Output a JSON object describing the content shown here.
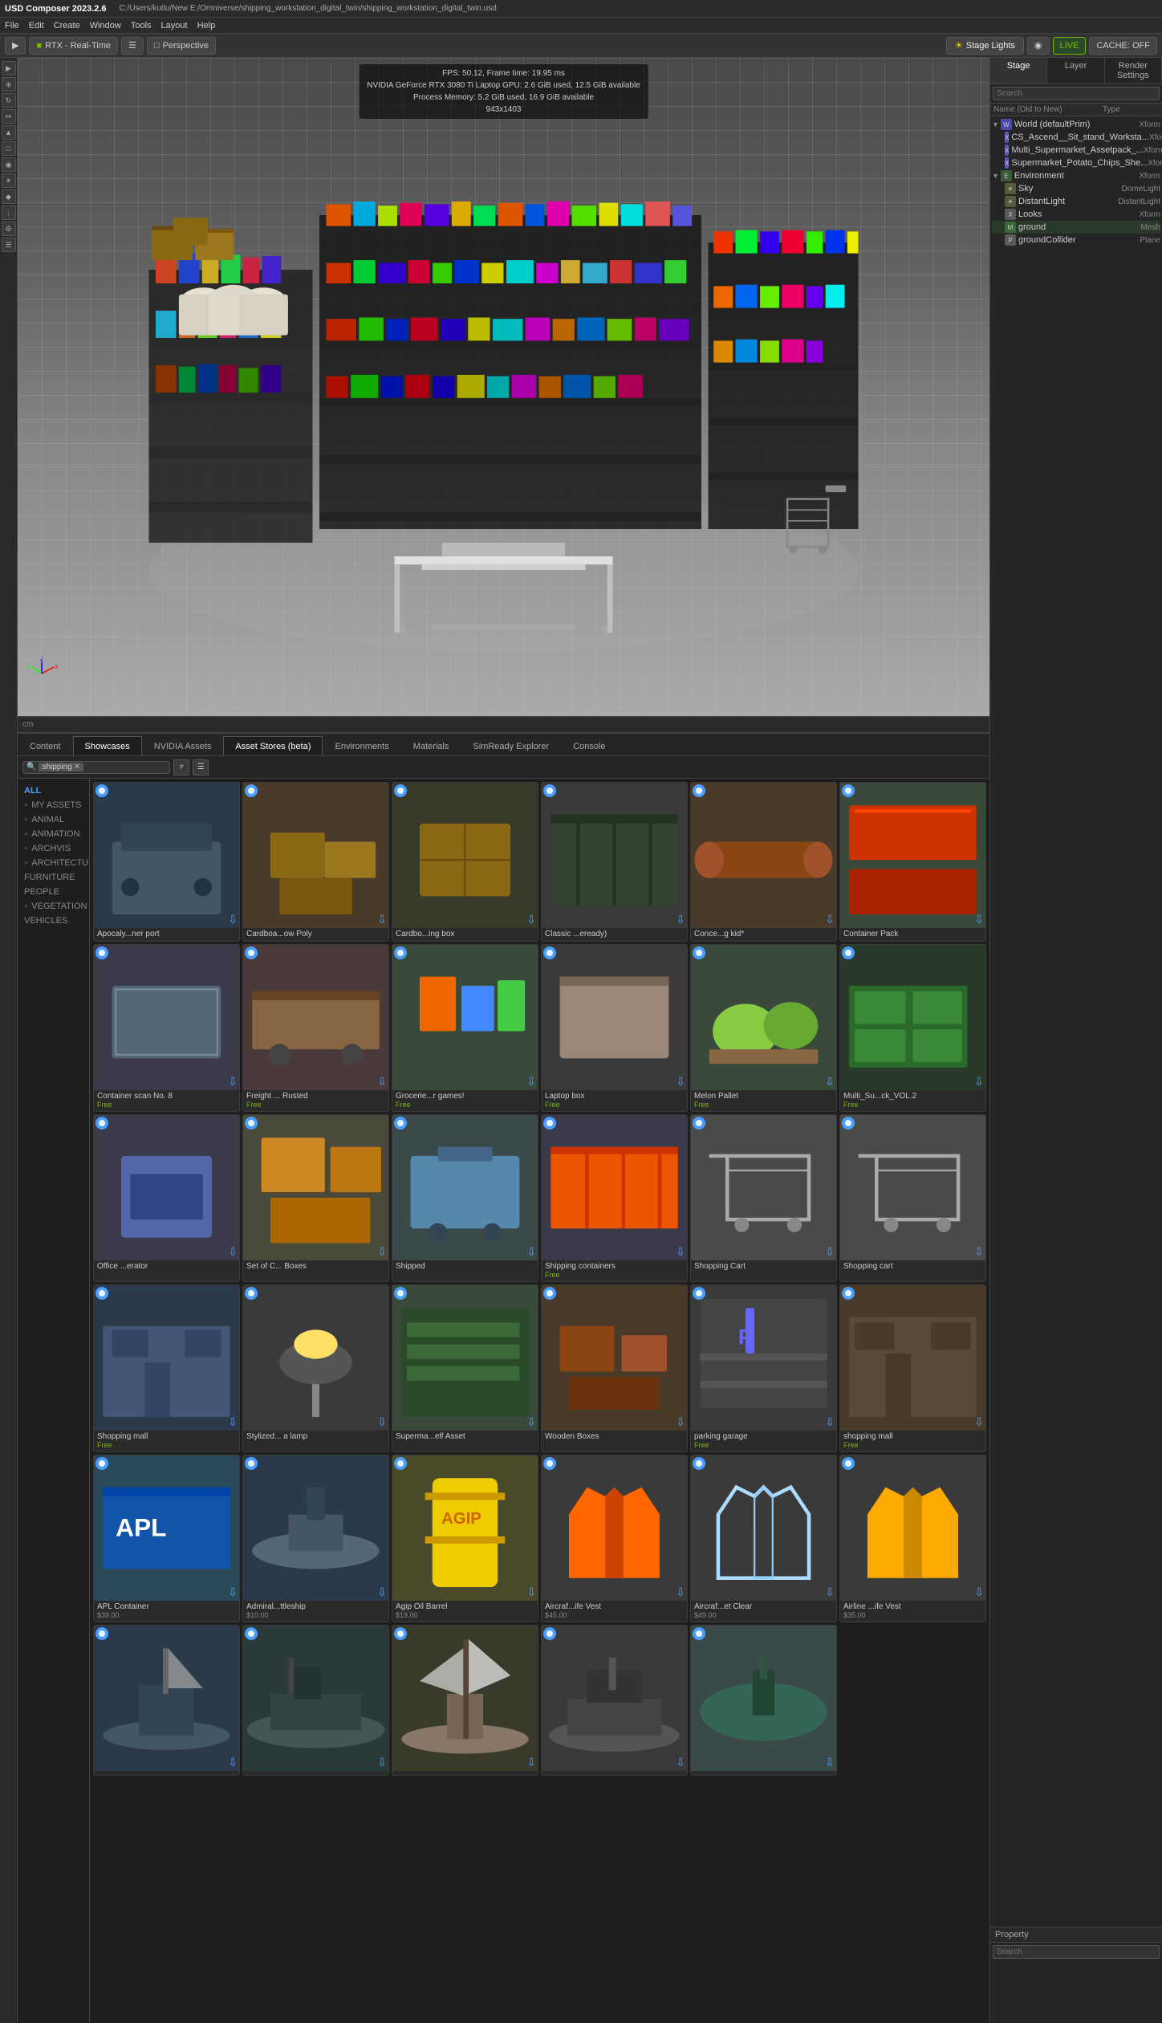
{
  "app": {
    "title": "USD Composer  2023.2.6",
    "file_path": "C:/Users/kutlu/New E:/Omniverse/shipping_workstation_digital_twin/shipping_workstation_digital_twin.usd"
  },
  "menu": {
    "items": [
      "File",
      "Edit",
      "Create",
      "Window",
      "Tools",
      "Layout",
      "Help"
    ]
  },
  "toolbar": {
    "rtx_label": "RTX - Real-Time",
    "perspective_label": "Perspective",
    "stage_lights_label": "Stage Lights",
    "live_label": "LIVE",
    "cache_label": "CACHE: OFF"
  },
  "hud": {
    "line1": "FPS: 50.12, Frame time: 19.95 ms",
    "line2": "NVIDIA GeForce RTX 3080 Ti Laptop GPU: 2.6 GiB used, 12.5 GiB available",
    "line3": "Process Memory: 5.2 GiB used, 16.9 GiB available",
    "resolution": "943x1403"
  },
  "viewport_bottom": {
    "unit": "cm"
  },
  "right_panel": {
    "tabs": [
      "Stage",
      "Layer",
      "Render Settings"
    ],
    "search_placeholder": "Search",
    "tree": {
      "columns": [
        "Name (Old to New)",
        "Type"
      ],
      "items": [
        {
          "indent": 0,
          "arrow": "▼",
          "label": "World (defaultPrim)",
          "type": "Xform",
          "icon_color": "#4a9eff",
          "has_vis": true
        },
        {
          "indent": 1,
          "arrow": "",
          "label": "CS_Ascend__Sit_stand_Worksta...",
          "type": "Xform",
          "icon_color": "#888"
        },
        {
          "indent": 1,
          "arrow": "",
          "label": "Multi_Supermarket_Assetpack_...",
          "type": "Xform",
          "icon_color": "#888"
        },
        {
          "indent": 1,
          "arrow": "",
          "label": "Supermarket_Potato_Chips_She...",
          "type": "Xform",
          "icon_color": "#888"
        },
        {
          "indent": 0,
          "arrow": "▼",
          "label": "Environment",
          "type": "Xform",
          "icon_color": "#888",
          "expanded": true
        },
        {
          "indent": 1,
          "arrow": "",
          "label": "Sky",
          "type": "DomeLight",
          "icon_color": "#aaa"
        },
        {
          "indent": 1,
          "arrow": "",
          "label": "DistantLight",
          "type": "DistantLight",
          "icon_color": "#aaa"
        },
        {
          "indent": 1,
          "arrow": "",
          "label": "Looks",
          "type": "Xform",
          "icon_color": "#888"
        },
        {
          "indent": 1,
          "arrow": "",
          "label": "ground",
          "type": "Mesh",
          "icon_color": "#888"
        },
        {
          "indent": 1,
          "arrow": "",
          "label": "groundCollider",
          "type": "Plane",
          "icon_color": "#888"
        }
      ]
    }
  },
  "property_panel": {
    "title": "Property",
    "search_placeholder": "Search"
  },
  "asset_browser": {
    "tabs": [
      "Content",
      "Showcases",
      "NVIDIA Assets",
      "Asset Stores (beta)",
      "Environments",
      "Materials",
      "SimReady Explorer",
      "Console"
    ],
    "active_tab": "Asset Stores (beta)",
    "search_tag": "shipping",
    "categories": [
      {
        "label": "ALL",
        "active": true
      },
      {
        "label": "+ MY ASSETS",
        "sub": false
      },
      {
        "label": "+ ANIMAL",
        "sub": false
      },
      {
        "label": "+ ANIMATION",
        "sub": false
      },
      {
        "label": "+ ARCHVIS",
        "sub": false
      },
      {
        "label": "+ ARCHITECTURE",
        "sub": false
      },
      {
        "label": "FURNITURE",
        "sub": false
      },
      {
        "label": "PEOPLE",
        "sub": false
      },
      {
        "label": "+ VEGETATION",
        "sub": false
      },
      {
        "label": "VEHICLES",
        "sub": false
      }
    ],
    "assets": [
      {
        "name": "Apocaly...ner port",
        "price": "",
        "price_type": "paid",
        "badge": "omni",
        "bg": "#2a3a4a",
        "shape": "port"
      },
      {
        "name": "Cardboa...ow Poly",
        "price": "",
        "price_type": "paid",
        "badge": "omni",
        "bg": "#4a3a2a",
        "shape": "boxes"
      },
      {
        "name": "Cardbo...ing box",
        "price": "",
        "price_type": "paid",
        "badge": "omni",
        "bg": "#3a3a2a",
        "shape": "box"
      },
      {
        "name": "Classic ...eready)",
        "price": "",
        "price_type": "paid",
        "badge": "omni",
        "bg": "#3a3a3a",
        "shape": "container_dark"
      },
      {
        "name": "Conce...g kid*",
        "price": "",
        "price_type": "paid",
        "badge": "omni",
        "bg": "#4a3a2a",
        "shape": "logs"
      },
      {
        "name": "Container Pack",
        "price": "",
        "price_type": "paid",
        "badge": "omni",
        "bg": "#3a4a3a",
        "shape": "containers_red"
      },
      {
        "name": "Container scan No. 8",
        "price": "Free",
        "price_type": "free",
        "badge": "omni",
        "bg": "#3a3a4a",
        "shape": "container_scan"
      },
      {
        "name": "Freight ... Rusted",
        "price": "Free",
        "price_type": "free",
        "badge": "omni",
        "bg": "#4a3a3a",
        "shape": "freight"
      },
      {
        "name": "Grocerie...r games!",
        "price": "Free",
        "price_type": "free",
        "badge": "omni",
        "bg": "#3a4a3a",
        "shape": "groceries"
      },
      {
        "name": "Laptop box",
        "price": "Free",
        "price_type": "free",
        "badge": "omni",
        "bg": "#3a3a3a",
        "shape": "laptopbox"
      },
      {
        "name": "Melon Pallet",
        "price": "Free",
        "price_type": "free",
        "badge": "omni",
        "bg": "#3a4a3a",
        "shape": "melon"
      },
      {
        "name": "Multi_Su...ck_VOL.2",
        "price": "Free",
        "price_type": "free",
        "badge": "omni",
        "bg": "#2a3a2a",
        "shape": "multipack"
      },
      {
        "name": "Office ...erator",
        "price": "",
        "price_type": "paid",
        "badge": "omni",
        "bg": "#3a3a4a",
        "shape": "office"
      },
      {
        "name": "Set of C... Boxes",
        "price": "",
        "price_type": "paid",
        "badge": "omni",
        "bg": "#4a4a3a",
        "shape": "setboxes"
      },
      {
        "name": "Shipped",
        "price": "",
        "price_type": "paid",
        "badge": "omni",
        "bg": "#3a4a4a",
        "shape": "shipped"
      },
      {
        "name": "Shipping containers",
        "price": "Free",
        "price_type": "free",
        "badge": "omni",
        "bg": "#3a3a4a",
        "shape": "shippingcont"
      },
      {
        "name": "Shopping Cart",
        "price": "",
        "price_type": "paid",
        "badge": "omni",
        "bg": "#4a4a4a",
        "shape": "cart"
      },
      {
        "name": "Shopping cart",
        "price": "",
        "price_type": "paid",
        "badge": "omni",
        "bg": "#4a4a4a",
        "shape": "cart2"
      },
      {
        "name": "Shopping mall",
        "price": "Free",
        "price_type": "free",
        "badge": "omni",
        "bg": "#2a3a4a",
        "shape": "mall"
      },
      {
        "name": "Stylized... a lamp",
        "price": "",
        "price_type": "paid",
        "badge": "omni",
        "bg": "#3a3a3a",
        "shape": "lamp"
      },
      {
        "name": "Superma...elf Asset",
        "price": "",
        "price_type": "paid",
        "badge": "omni",
        "bg": "#3a4a3a",
        "shape": "supermarket"
      },
      {
        "name": "Wooden Boxes",
        "price": "",
        "price_type": "paid",
        "badge": "omni",
        "bg": "#4a3a2a",
        "shape": "wooden"
      },
      {
        "name": "parking garage",
        "price": "Free",
        "price_type": "free",
        "badge": "omni",
        "bg": "#3a3a3a",
        "shape": "parking"
      },
      {
        "name": "shopping mall",
        "price": "Free",
        "price_type": "free",
        "badge": "omni",
        "bg": "#4a3a2a",
        "shape": "mall2"
      },
      {
        "name": "APL Container",
        "price": "$39.00",
        "price_type": "paid",
        "badge": "omni",
        "bg": "#2a4a5a",
        "shape": "apl"
      },
      {
        "name": "Admiral...ttleship",
        "price": "$10.00",
        "price_type": "paid",
        "badge": "omni",
        "bg": "#2a3a4a",
        "shape": "battleship"
      },
      {
        "name": "Agip Oil Barrel",
        "price": "$19.00",
        "price_type": "paid",
        "badge": "omni",
        "bg": "#4a4a2a",
        "shape": "barrel"
      },
      {
        "name": "Aircraf...ife Vest",
        "price": "$45.00",
        "price_type": "paid",
        "badge": "omni",
        "bg": "#3a3a3a",
        "shape": "vest"
      },
      {
        "name": "Aircraf...et Clear",
        "price": "$49.00",
        "price_type": "paid",
        "badge": "omni",
        "bg": "#3a3a3a",
        "shape": "vesttransparent"
      },
      {
        "name": "Airline ...ife Vest",
        "price": "$35.00",
        "price_type": "paid",
        "badge": "omni",
        "bg": "#3a3a3a",
        "shape": "vest2"
      },
      {
        "name": "",
        "price": "",
        "price_type": "",
        "badge": "omni",
        "bg": "#2a3a4a",
        "shape": "yacht"
      },
      {
        "name": "",
        "price": "",
        "price_type": "",
        "badge": "omni",
        "bg": "#2a3a3a",
        "shape": "warship"
      },
      {
        "name": "",
        "price": "",
        "price_type": "",
        "badge": "omni",
        "bg": "#3a3a2a",
        "shape": "sailship"
      },
      {
        "name": "",
        "price": "",
        "price_type": "",
        "badge": "omni",
        "bg": "#3a3a3a",
        "shape": "frigate"
      },
      {
        "name": "",
        "price": "",
        "price_type": "",
        "badge": "omni",
        "bg": "#3a4a4a",
        "shape": "sub"
      }
    ]
  }
}
